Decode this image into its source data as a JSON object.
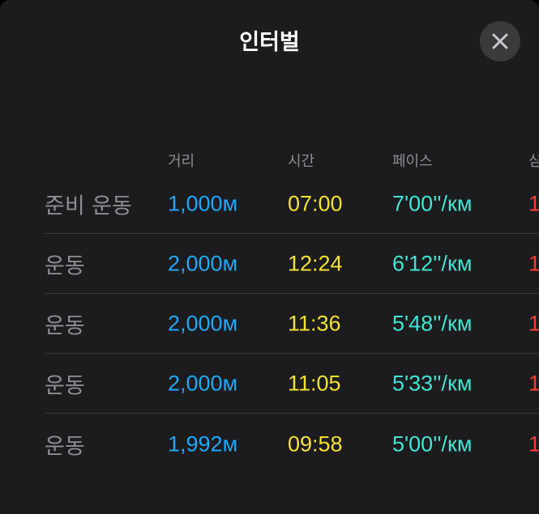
{
  "header": {
    "title": "인터벌",
    "close_icon": "close-icon"
  },
  "columns": {
    "distance": "거리",
    "time": "시간",
    "pace": "페이스",
    "heart_rate_partial": "심"
  },
  "rows": [
    {
      "label": "준비 운동",
      "distance": "1,000м",
      "time": "07:00",
      "pace": "7'00''/км",
      "hr_partial": "1"
    },
    {
      "label": "운동",
      "distance": "2,000м",
      "time": "12:24",
      "pace": "6'12''/км",
      "hr_partial": "1"
    },
    {
      "label": "운동",
      "distance": "2,000м",
      "time": "11:36",
      "pace": "5'48''/км",
      "hr_partial": "1"
    },
    {
      "label": "운동",
      "distance": "2,000м",
      "time": "11:05",
      "pace": "5'33''/км",
      "hr_partial": "1"
    },
    {
      "label": "운동",
      "distance": "1,992м",
      "time": "09:58",
      "pace": "5'00''/км",
      "hr_partial": "1"
    }
  ],
  "colors": {
    "background": "#1c1c1e",
    "distance": "#1fa8f5",
    "time": "#f5e130",
    "pace": "#3ee6d4",
    "heart_rate": "#ff3b30",
    "label": "#8e8e93"
  }
}
